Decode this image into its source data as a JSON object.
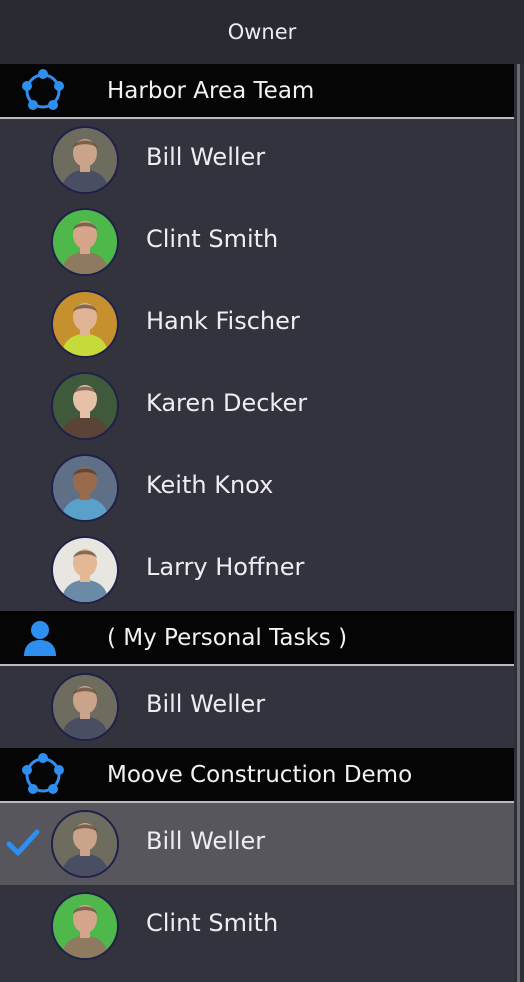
{
  "header": {
    "title": "Owner"
  },
  "groups": [
    {
      "label": "Harbor Area Team",
      "icon": "team-circle-icon",
      "members": [
        {
          "name": "Bill Weller",
          "avatar_bg": "#6e6b5f",
          "skin": "#c9a48a",
          "shirt": "#4a4e63"
        },
        {
          "name": "Clint Smith",
          "avatar_bg": "#4fb84a",
          "skin": "#d4a58a",
          "shirt": "#8d7a5f"
        },
        {
          "name": "Hank Fischer",
          "avatar_bg": "#c7902f",
          "skin": "#e0b495",
          "shirt": "#c6db3a"
        },
        {
          "name": "Karen Decker",
          "avatar_bg": "#3f5a3a",
          "skin": "#e7c0a8",
          "shirt": "#5b4436"
        },
        {
          "name": "Keith Knox",
          "avatar_bg": "#5f6f86",
          "skin": "#9a6a4e",
          "shirt": "#5aa0c8"
        },
        {
          "name": "Larry Hoffner",
          "avatar_bg": "#e8e6e1",
          "skin": "#e2b896",
          "shirt": "#6a8aa6"
        }
      ]
    },
    {
      "label": "( My Personal Tasks )",
      "icon": "person-icon",
      "members": [
        {
          "name": "Bill Weller",
          "avatar_bg": "#6e6b5f",
          "skin": "#c9a48a",
          "shirt": "#4a4e63"
        }
      ]
    },
    {
      "label": "Moove Construction Demo",
      "icon": "team-circle-icon",
      "members": [
        {
          "name": "Bill Weller",
          "avatar_bg": "#6e6b5f",
          "skin": "#c9a48a",
          "shirt": "#4a4e63",
          "selected": true
        },
        {
          "name": "Clint Smith",
          "avatar_bg": "#4fb84a",
          "skin": "#d4a58a",
          "shirt": "#8d7a5f"
        }
      ]
    }
  ],
  "colors": {
    "accent": "#2f8ff0",
    "group_bg": "#050505",
    "row_bg": "#33333d",
    "selected_bg": "#56565c"
  }
}
